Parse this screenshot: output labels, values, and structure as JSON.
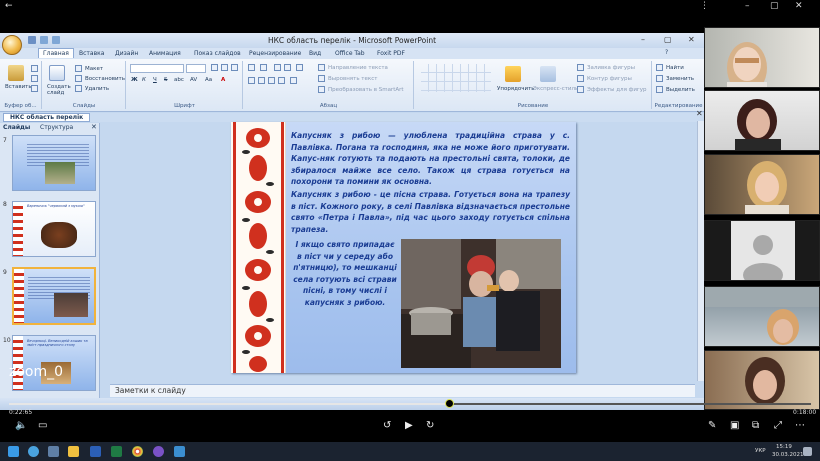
{
  "player": {
    "back_glyph": "←",
    "menu_glyph": "⋮",
    "window_controls": [
      "–",
      "▢",
      "✕"
    ],
    "zoom_label": "zoom_0",
    "elapsed": "0:22:65",
    "duration": "0:18:00",
    "progress_fraction": 0.55,
    "controls": {
      "volume": "volume-icon",
      "captions": "captions-icon",
      "rewind": "rewind-10-icon",
      "play": "play-icon",
      "forward": "forward-10-icon",
      "edit": "pencil-icon",
      "cast": "cast-icon",
      "pip": "picture-in-picture-icon",
      "fullscreen": "fullscreen-icon",
      "more": "more-icon"
    }
  },
  "ppt": {
    "window_title": "НКС область перелік - Microsoft PowerPoint",
    "window_controls": [
      "–",
      "▢",
      "✕"
    ],
    "tabs": [
      "Главная",
      "Вставка",
      "Дизайн",
      "Анимация",
      "Показ слайдов",
      "Рецензирование",
      "Вид",
      "Office Tab",
      "Foxit PDF"
    ],
    "active_tab": "Главная",
    "ribbon": {
      "clipboard": {
        "paste": "Вставить",
        "label": "Буфер об..."
      },
      "slides": {
        "new_slide": "Создать слайд",
        "layout": "Макет",
        "reset": "Восстановить",
        "delete": "Удалить",
        "label": "Слайды"
      },
      "font": {
        "label": "Шрифт",
        "bold": "Ж",
        "italic": "К",
        "underline": "Ч",
        "strike": "S",
        "shadow": "abc",
        "spacing": "AV",
        "case": "Aa",
        "color": "A"
      },
      "paragraph": {
        "text_direction": "Направление текста",
        "align_text": "Выровнять текст",
        "smartart": "Преобразовать в SmartArt",
        "label": "Абзац"
      },
      "drawing": {
        "arrange": "Упорядочить",
        "quick_styles": "Экспресс-стили",
        "fill": "Заливка фигуры",
        "outline": "Контур фигуры",
        "effects": "Эффекты для фигур",
        "label": "Рисование"
      },
      "editing": {
        "find": "Найти",
        "replace": "Заменить",
        "select": "Выделить",
        "label": "Редактирование"
      }
    },
    "doc_tab": "НКС область перелік",
    "panel_tabs": [
      "Слайды",
      "Структура"
    ],
    "slide_numbers": [
      "7",
      "8",
      "9",
      "10"
    ],
    "thumb8_title": "Вареничок \"червоний з мукою\"",
    "thumb10_title": "Вечорниці. Великодній кошик та зміст праздничного столу",
    "notes_placeholder": "Заметки к слайду",
    "slide": {
      "para1": "Капусняк з рибою — улюблена традиційна страва у с. Павлівка. Погана та господиня, яка не може його приготувати. Капус-няк готують та подають на престольні свята, толоки, де збиралося майже все село. Також ця страва готується на похорони та помини як основна.",
      "para2": "Капусняк з рибою - це пісна страва. Готується вона на трапезу в піст. Кожного року, в селі Павлівка відзначається престольне свято «Петра і Павла», під час цього заходу готується спільна трапеза.",
      "para3": "І якщо свято припадає в піст чи у середу або п'ятницю), то мешканці села готують всі страви пісні, в тому числі і капусняк з рибою."
    }
  },
  "taskbar": {
    "clock_time": "15:19",
    "clock_date": "30.03.2021",
    "language": "УКР"
  },
  "colors": {
    "slide_text": "#1a3c93",
    "ornament_red": "#d0301e",
    "progress_knob": "#d9dd4b"
  }
}
